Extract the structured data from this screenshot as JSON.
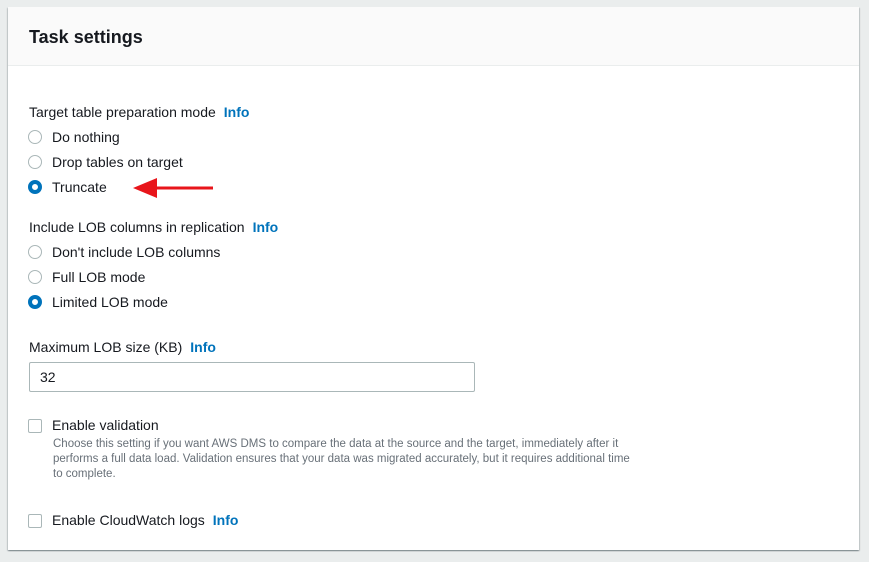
{
  "panel": {
    "title": "Task settings"
  },
  "target_prep": {
    "label": "Target table preparation mode",
    "info": "Info",
    "options": [
      {
        "label": "Do nothing",
        "selected": false
      },
      {
        "label": "Drop tables on target",
        "selected": false
      },
      {
        "label": "Truncate",
        "selected": true
      }
    ]
  },
  "lob": {
    "label": "Include LOB columns in replication",
    "info": "Info",
    "options": [
      {
        "label": "Don't include LOB columns",
        "selected": false
      },
      {
        "label": "Full LOB mode",
        "selected": false
      },
      {
        "label": "Limited LOB mode",
        "selected": true
      }
    ]
  },
  "max_lob": {
    "label": "Maximum LOB size (KB)",
    "info": "Info",
    "value": "32"
  },
  "validation": {
    "label": "Enable validation",
    "checked": false,
    "description": "Choose this setting if you want AWS DMS to compare the data at the source and the target, immediately after it performs a full data load. Validation ensures that your data was migrated accurately, but it requires additional time to complete."
  },
  "cloudwatch": {
    "label": "Enable CloudWatch logs",
    "info": "Info",
    "checked": false
  },
  "annotation": {
    "icon": "red-arrow-icon",
    "color": "#e8151b"
  },
  "colors": {
    "accent": "#0073bb",
    "text": "#16191f",
    "muted": "#687078"
  }
}
